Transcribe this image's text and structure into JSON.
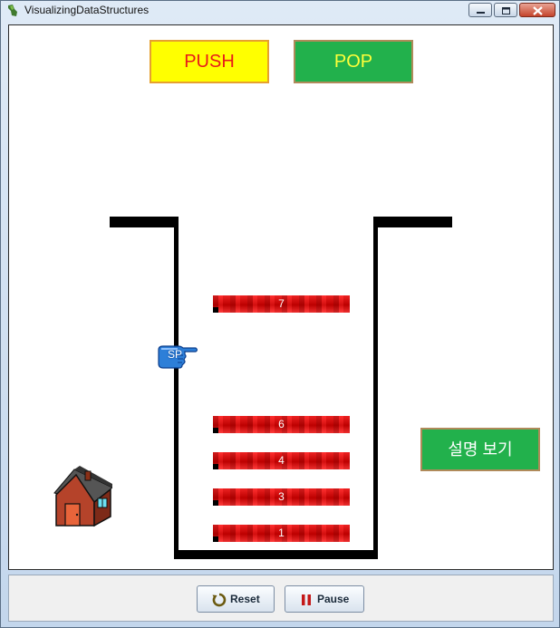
{
  "window": {
    "title": "VisualizingDataStructures"
  },
  "controls": {
    "push_label": "PUSH",
    "pop_label": "POP",
    "help_label": "설명 보기"
  },
  "stack": {
    "pointer_label": "SP",
    "items": [
      "7",
      "6",
      "4",
      "3",
      "1"
    ]
  },
  "footer": {
    "reset_label": "Reset",
    "pause_label": "Pause"
  },
  "colors": {
    "push_bg": "#ffff00",
    "push_text": "#e81a1a",
    "pop_bg": "#22b14c",
    "pop_text": "#ffff3a",
    "block": "#e00000"
  }
}
